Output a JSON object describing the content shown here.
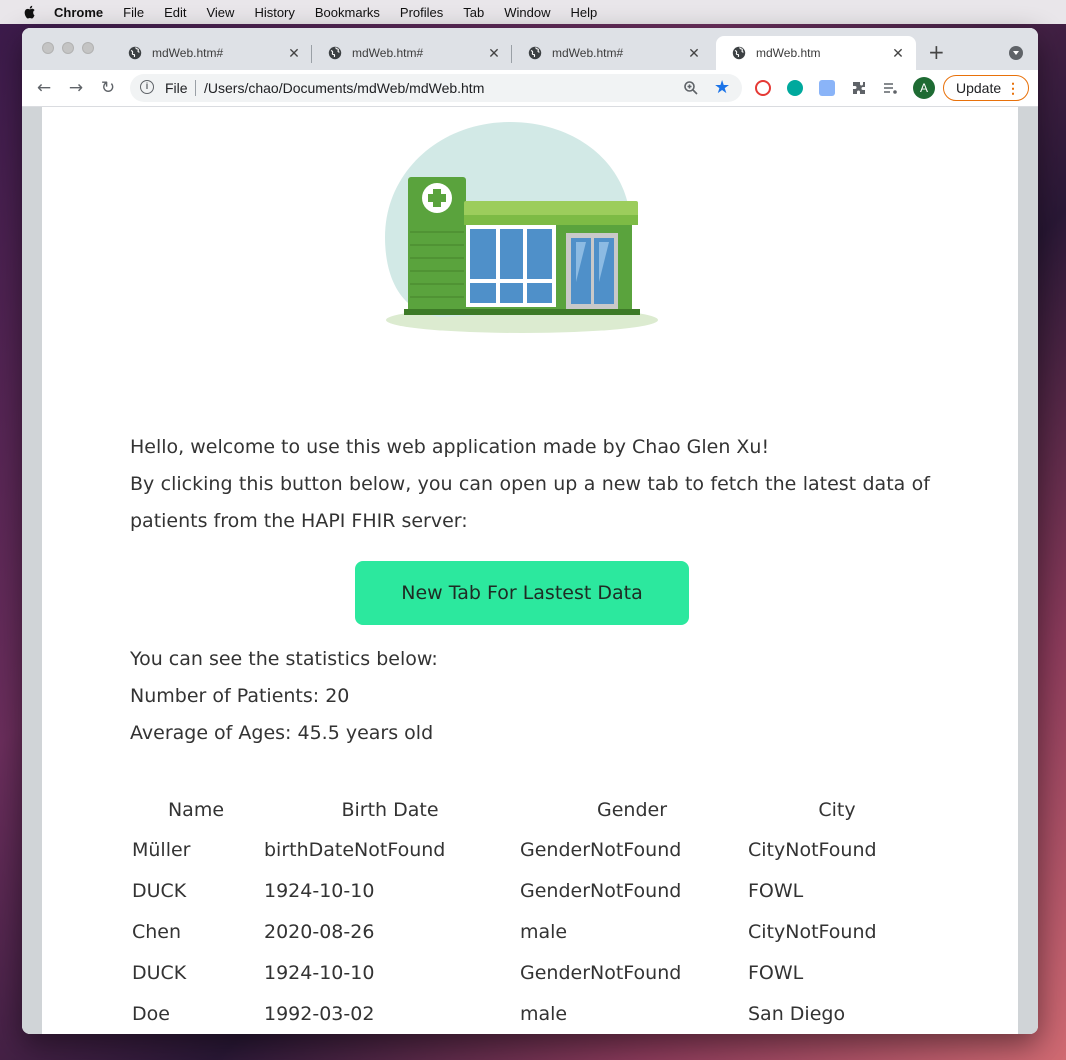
{
  "menubar": {
    "app": "Chrome",
    "items": [
      "File",
      "Edit",
      "View",
      "History",
      "Bookmarks",
      "Profiles",
      "Tab",
      "Window",
      "Help"
    ]
  },
  "tabs": [
    {
      "title": "mdWeb.htm#",
      "active": false
    },
    {
      "title": "mdWeb.htm#",
      "active": false
    },
    {
      "title": "mdWeb.htm#",
      "active": false
    },
    {
      "title": "mdWeb.htm",
      "active": true
    }
  ],
  "toolbar": {
    "scheme": "File",
    "url": "/Users/chao/Documents/mdWeb/mdWeb.htm",
    "avatar_letter": "A",
    "update_label": "Update",
    "update_dots": "⋮"
  },
  "page": {
    "welcome": "Hello, welcome to use this web application made by Chao Glen Xu!",
    "instructions": "By clicking this button below, you can open up a new tab to fetch the latest data of patients from the HAPI FHIR server:",
    "button_label": "New Tab For Lastest Data",
    "stats_intro": "You can see the statistics below:",
    "num_patients": "Number of Patients: 20",
    "avg_age": "Average of Ages: 45.5 years old"
  },
  "table": {
    "headers": [
      "Name",
      "Birth Date",
      "Gender",
      "City"
    ],
    "rows": [
      [
        "Müller",
        "birthDateNotFound",
        "GenderNotFound",
        "CityNotFound"
      ],
      [
        "DUCK",
        "1924-10-10",
        "GenderNotFound",
        "FOWL"
      ],
      [
        "Chen",
        "2020-08-26",
        "male",
        "CityNotFound"
      ],
      [
        "DUCK",
        "1924-10-10",
        "GenderNotFound",
        "FOWL"
      ],
      [
        "Doe",
        "1992-03-02",
        "male",
        "San Diego"
      ]
    ]
  },
  "colors": {
    "button": "#2ce89e",
    "accent_blue": "#1a73e8",
    "update_orange": "#e8710a"
  }
}
